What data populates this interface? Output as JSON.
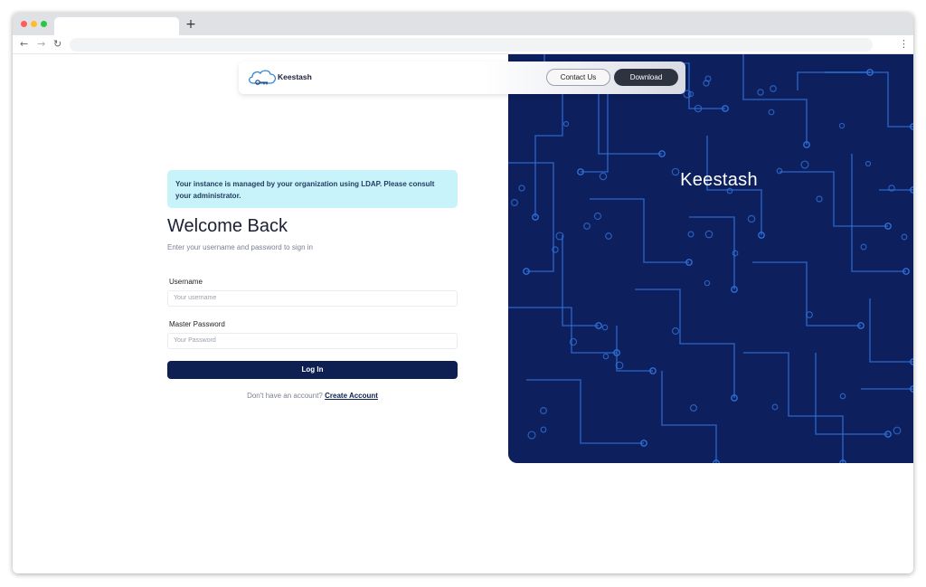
{
  "browser": {
    "new_tab_glyph": "+",
    "back_icon": "←",
    "forward_icon": "→",
    "reload_icon": "↻",
    "menu_icon": "⋮"
  },
  "header": {
    "brand_name": "Keestash",
    "contact_label": "Contact Us",
    "download_label": "Download"
  },
  "hero": {
    "title": "Keestash"
  },
  "notice": {
    "text": "Your instance is managed by your organization using LDAP. Please consult your administrator."
  },
  "login": {
    "title": "Welcome Back",
    "subtitle": "Enter your username and password to sign in",
    "username_label": "Username",
    "username_placeholder": "Your username",
    "password_label": "Master Password",
    "password_placeholder": "Your Password",
    "submit_label": "Log In",
    "signup_prompt": "Don't have an account?",
    "signup_link": "Create Account"
  },
  "colors": {
    "primary": "#0e1f52",
    "hero_bg": "#0d1f5c",
    "circuit": "#2f6fd6",
    "notice_bg": "#c8f3fb"
  }
}
